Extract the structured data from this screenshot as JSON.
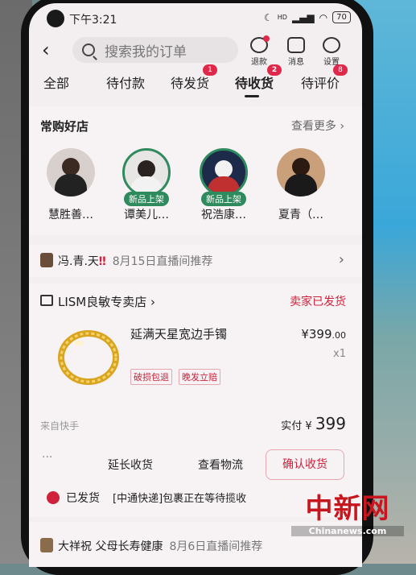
{
  "status_bar": {
    "time": "下午3:21",
    "network": "HD",
    "battery": "70"
  },
  "header": {
    "search_placeholder": "搜索我的订单",
    "icons": [
      {
        "label": "退款",
        "icon": "refund-icon"
      },
      {
        "label": "消息",
        "icon": "message-icon"
      },
      {
        "label": "设置",
        "icon": "settings-icon"
      }
    ]
  },
  "tabs": [
    {
      "label": "全部"
    },
    {
      "label": "待付款"
    },
    {
      "label": "待发货",
      "badge": "1"
    },
    {
      "label": "待收货",
      "badge": "2",
      "active": true
    },
    {
      "label": "待评价",
      "badge": "8"
    }
  ],
  "favorite_shops": {
    "title": "常购好店",
    "more": "查看更多",
    "shops": [
      {
        "name": "慧胜善…",
        "tag": ""
      },
      {
        "name": "谭美儿…",
        "tag": "新品上架"
      },
      {
        "name": "祝浩康…",
        "tag": "新品上架"
      },
      {
        "name": "夏青（…",
        "tag": ""
      }
    ]
  },
  "live_recommend_1": {
    "name": "冯.青.天",
    "marks": "‼",
    "note": "8月15日直播间推荐"
  },
  "order": {
    "store": "LISM良敏专卖店",
    "status": "卖家已发货",
    "product_name": "延满天星宽边手镯",
    "price_main": "¥399",
    "price_cents": ".00",
    "quantity": "x1",
    "tags": [
      "破损包退",
      "晚发立赔"
    ],
    "source": "来自快手",
    "paid_label": "实付 ¥",
    "paid_amount": "399",
    "more": "···",
    "buttons": {
      "extend": "延长收货",
      "logistics": "查看物流",
      "confirm": "确认收货"
    }
  },
  "shipping": {
    "label": "已发货",
    "text": "[中通快递]包裹正在等待揽收"
  },
  "live_recommend_2": {
    "name": "大祥祝",
    "text": "父母长寿健康",
    "note": "8月6日直播间推荐"
  },
  "watermark": {
    "cn": "中新网",
    "en": "Chinanews.com"
  },
  "colors": {
    "accent": "#d0213b",
    "green_tag": "#2f8a5e"
  }
}
